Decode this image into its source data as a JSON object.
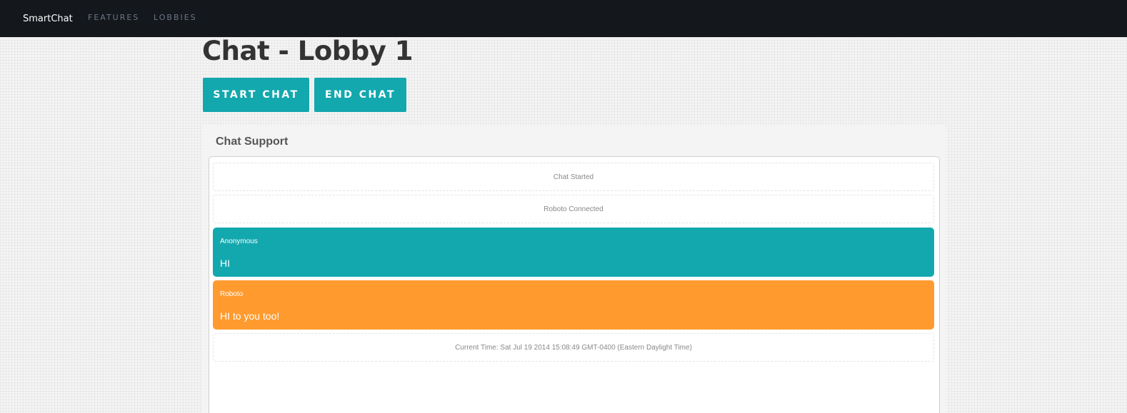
{
  "nav": {
    "brand": "SmartChat",
    "links": [
      "FEATURES",
      "LOBBIES"
    ]
  },
  "page": {
    "title": "Chat - Lobby 1"
  },
  "actions": {
    "start_label": "START CHAT",
    "end_label": "END CHAT"
  },
  "chat": {
    "panel_title": "Chat Support",
    "system_messages": [
      "Chat Started",
      "Roboto Connected",
      "Current Time: Sat Jul 19 2014 15:08:49 GMT-0400 (Eastern Daylight Time)"
    ],
    "messages": [
      {
        "author": "Anonymous",
        "text": "HI"
      },
      {
        "author": "Roboto",
        "text": "HI to you too!"
      }
    ]
  },
  "colors": {
    "navbar": "#14171c",
    "accent_teal": "#13a8ae",
    "accent_orange": "#ff9a2e",
    "title": "#333333"
  }
}
